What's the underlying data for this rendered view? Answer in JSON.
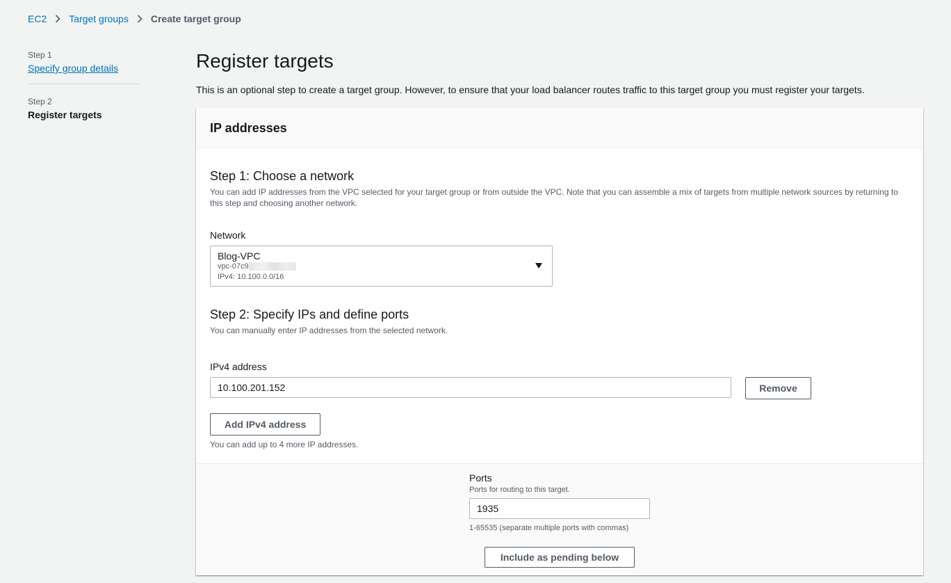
{
  "breadcrumb": {
    "items": [
      "EC2",
      "Target groups"
    ],
    "current": "Create target group"
  },
  "steps": {
    "step1_label": "Step 1",
    "step1_title": "Specify group details",
    "step2_label": "Step 2",
    "step2_title": "Register targets"
  },
  "page": {
    "title": "Register targets",
    "description": "This is an optional step to create a target group. However, to ensure that your load balancer routes traffic to this target group you must register your targets."
  },
  "panel": {
    "header": "IP addresses",
    "step1": {
      "title": "Step 1: Choose a network",
      "description": "You can add IP addresses from the VPC selected for your target group or from outside the VPC. Note that you can assemble a mix of targets from multiple network sources by returning to this step and choosing another network.",
      "network_label": "Network",
      "network_name": "Blog-VPC",
      "network_vpc": "vpc-07c9",
      "network_ipv4": "IPv4: 10.100.0.0/16"
    },
    "step2": {
      "title": "Step 2: Specify IPs and define ports",
      "description": "You can manually enter IP addresses from the selected network.",
      "ipv4_label": "IPv4 address",
      "ipv4_value": "10.100.201.152",
      "remove_label": "Remove",
      "add_label": "Add IPv4 address",
      "add_hint": "You can add up to 4 more IP addresses."
    },
    "ports": {
      "label": "Ports",
      "description": "Ports for routing to this target.",
      "value": "1935",
      "hint": "1-65535 (separate multiple ports with commas)",
      "include_label": "Include as pending below"
    }
  }
}
